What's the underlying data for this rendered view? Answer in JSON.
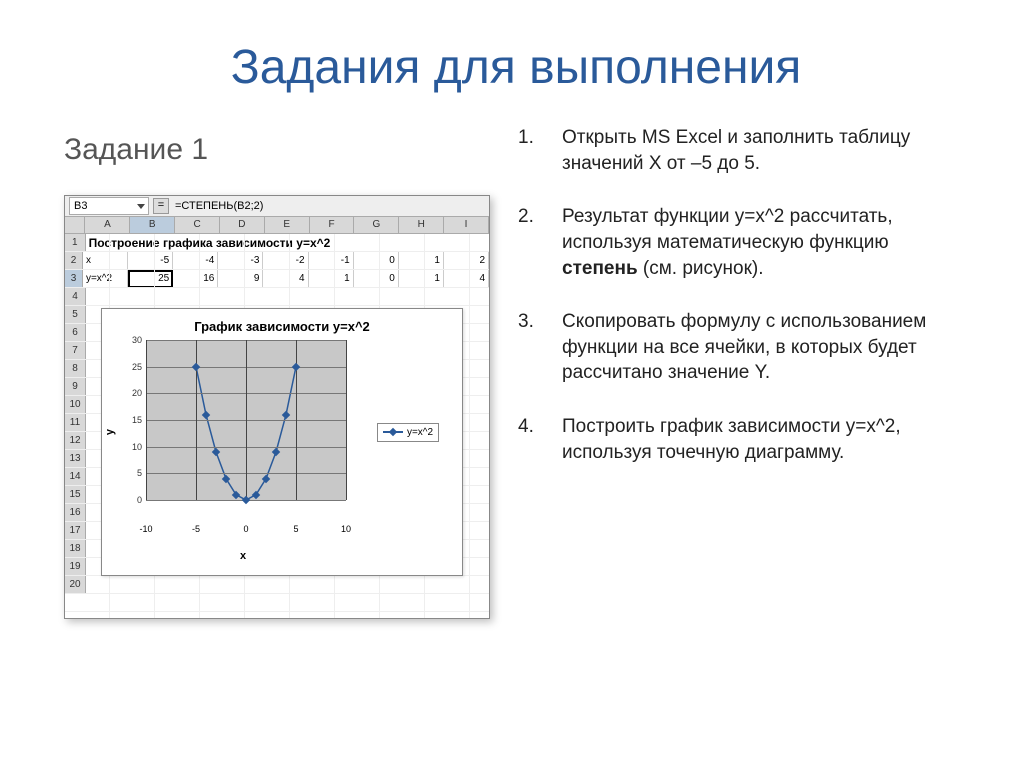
{
  "title": "Задания для выполнения",
  "subtitle": "Задание 1",
  "excel": {
    "name_box": "B3",
    "formula_eq": "=",
    "formula": "=СТЕПЕНЬ(B2;2)",
    "columns": [
      "A",
      "B",
      "C",
      "D",
      "E",
      "F",
      "G",
      "H",
      "I"
    ],
    "row_labels": [
      "1",
      "2",
      "3",
      "4",
      "5",
      "6",
      "7",
      "8",
      "9",
      "10",
      "11",
      "12",
      "13",
      "14",
      "15",
      "16",
      "17",
      "18",
      "19",
      "20"
    ],
    "row1_title": "Построение графика зависимости y=x^2",
    "row2_label": "x",
    "row2_values": [
      "-5",
      "-4",
      "-3",
      "-2",
      "-1",
      "0",
      "1",
      "2"
    ],
    "row3_label": "y=x^2",
    "row3_values": [
      "25",
      "16",
      "9",
      "4",
      "1",
      "0",
      "1",
      "4"
    ],
    "selected_cell_value": "25"
  },
  "chart_data": {
    "type": "scatter",
    "title": "График зависимости y=x^2",
    "xlabel": "x",
    "ylabel": "y",
    "series": [
      {
        "name": "y=x^2",
        "x": [
          -5,
          -4,
          -3,
          -2,
          -1,
          0,
          1,
          2,
          3,
          4,
          5
        ],
        "y": [
          25,
          16,
          9,
          4,
          1,
          0,
          1,
          4,
          9,
          16,
          25
        ]
      }
    ],
    "xticks": [
      -10,
      -5,
      0,
      5,
      10
    ],
    "yticks": [
      0,
      5,
      10,
      15,
      20,
      25,
      30
    ],
    "xlim": [
      -10,
      10
    ],
    "ylim": [
      0,
      30
    ],
    "legend_position": "right",
    "grid": "horizontal"
  },
  "steps": [
    {
      "num": "1.",
      "text": "Открыть MS Excel и заполнить таблицу значений Х от –5 до 5."
    },
    {
      "num": "2.",
      "text_pre": "Результат функции y=x^2 рассчитать, используя математическую функцию ",
      "bold": "степень",
      "text_post": " (см. рисунок)."
    },
    {
      "num": "3.",
      "text": "Скопировать формулу с использованием функции на все ячейки, в которых будет рассчитано значение Y."
    },
    {
      "num": "4.",
      "text": "Построить график зависимости y=x^2, используя точечную диаграмму."
    }
  ]
}
